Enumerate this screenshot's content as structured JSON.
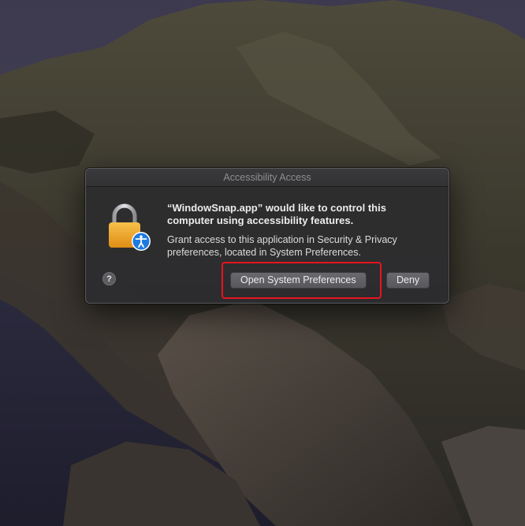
{
  "dialog": {
    "title": "Accessibility Access",
    "heading_line1": "“WindowSnap.app” would like to control this",
    "heading_line2": "computer using accessibility features.",
    "body_line1": "Grant access to this application in Security & Privacy",
    "body_line2": "preferences, located in System Preferences.",
    "help_label": "?",
    "open_button_label": "Open System Preferences",
    "deny_button_label": "Deny",
    "icon": "lock-accessibility-icon"
  },
  "colors": {
    "highlight": "#e8141e",
    "lock_body": "#f0a323",
    "accessibility_badge": "#1f7ae0"
  }
}
